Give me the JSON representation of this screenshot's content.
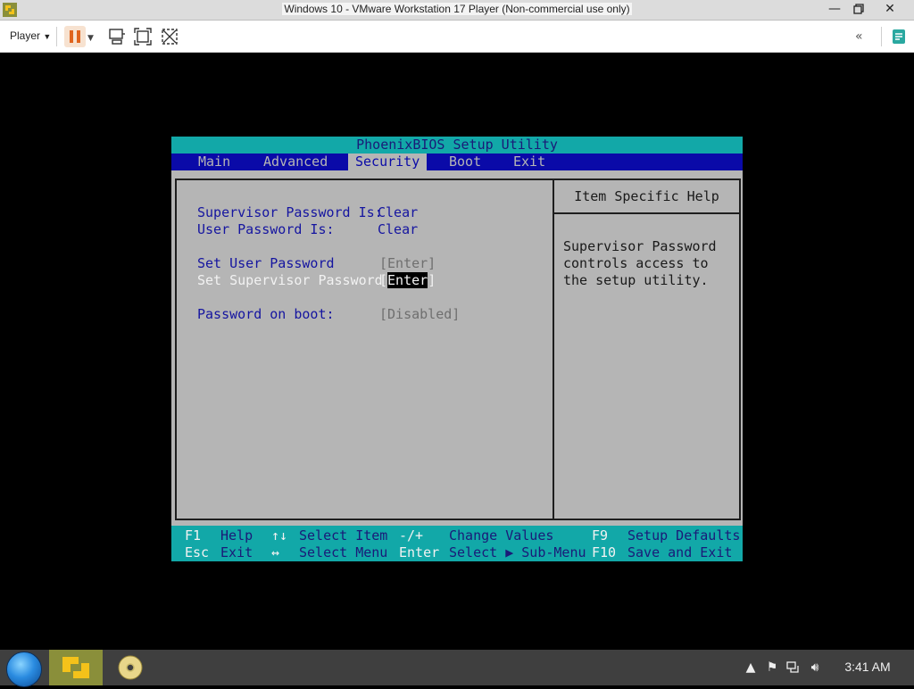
{
  "window": {
    "title": "Windows 10 - VMware Workstation 17 Player (Non-commercial use only)",
    "controls": [
      "minimize",
      "restore",
      "close"
    ]
  },
  "toolbar": {
    "player_label": "Player",
    "icons": [
      "pause-icon",
      "send-ctrl-alt-del-icon",
      "fit-guest-icon",
      "unity-icon",
      "collapse-icon",
      "notes-icon"
    ]
  },
  "bios": {
    "title": "PhoenixBIOS Setup Utility",
    "tabs": [
      "Main",
      "Advanced",
      "Security",
      "Boot",
      "Exit"
    ],
    "active_tab": "Security",
    "items": [
      {
        "label": "Supervisor Password Is:",
        "value": "Clear"
      },
      {
        "label": "User Password Is:",
        "value": "Clear"
      },
      {
        "label": "Set User Password",
        "value": "[Enter]"
      },
      {
        "label": "Set Supervisor Password",
        "value": "Enter"
      },
      {
        "label": "Password on boot:",
        "value": "[Disabled]"
      }
    ],
    "help": {
      "heading": "Item Specific Help",
      "text": "Supervisor Password controls access to the setup utility."
    },
    "footer": {
      "row1": [
        {
          "key": "F1",
          "desc": "Help"
        },
        {
          "key": "↑↓",
          "desc": "Select Item"
        },
        {
          "key": "-/+",
          "desc": "Change Values"
        },
        {
          "key": "F9",
          "desc": "Setup Defaults"
        }
      ],
      "row2": [
        {
          "key": "Esc",
          "desc": "Exit"
        },
        {
          "key": "↔",
          "desc": "Select Menu"
        },
        {
          "key": "Enter",
          "desc": "Select ▶ Sub-Menu"
        },
        {
          "key": "F10",
          "desc": "Save and Exit"
        }
      ]
    }
  },
  "taskbar": {
    "clock": "3:41 AM"
  },
  "colors": {
    "bios_cyan": "#12a8a8",
    "bios_blue": "#0a0aa8",
    "bios_gray": "#b5b5b5"
  }
}
